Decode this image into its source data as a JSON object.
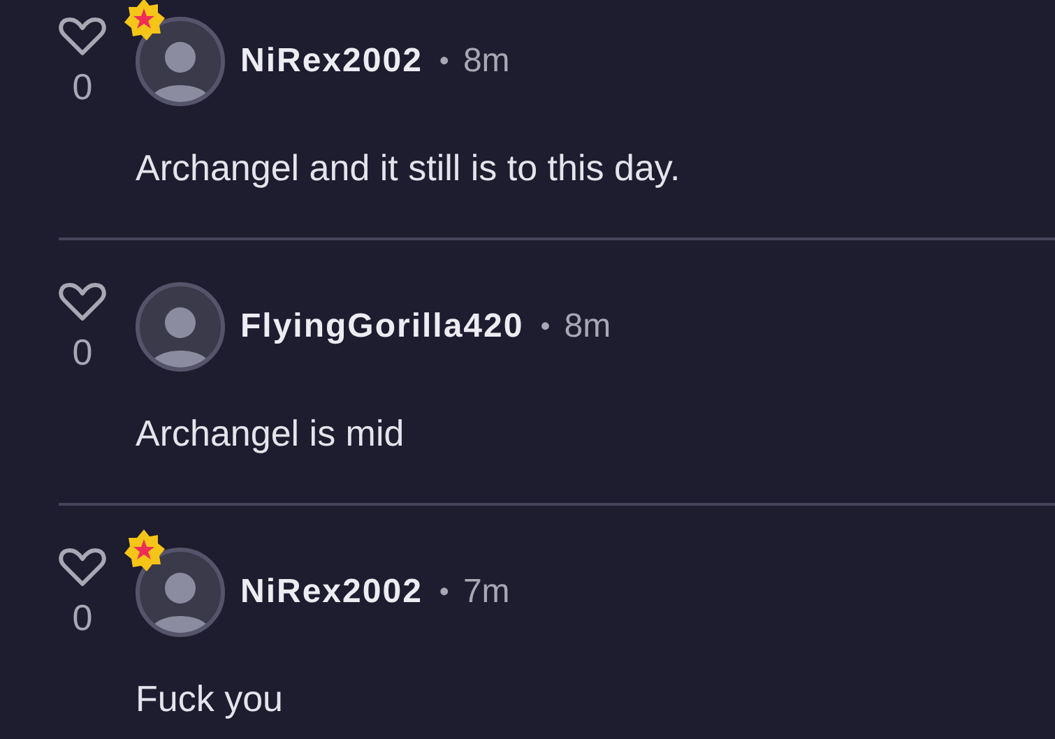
{
  "comments": [
    {
      "likes": "0",
      "badge": true,
      "username": "NiRex2002",
      "separator": "•",
      "time": "8m",
      "body": "Archangel and it still is to this day."
    },
    {
      "likes": "0",
      "badge": false,
      "username": "FlyingGorilla420",
      "separator": "•",
      "time": "8m",
      "body": "Archangel is mid"
    },
    {
      "likes": "0",
      "badge": true,
      "username": "NiRex2002",
      "separator": "•",
      "time": "7m",
      "body": "Fuck you"
    }
  ]
}
